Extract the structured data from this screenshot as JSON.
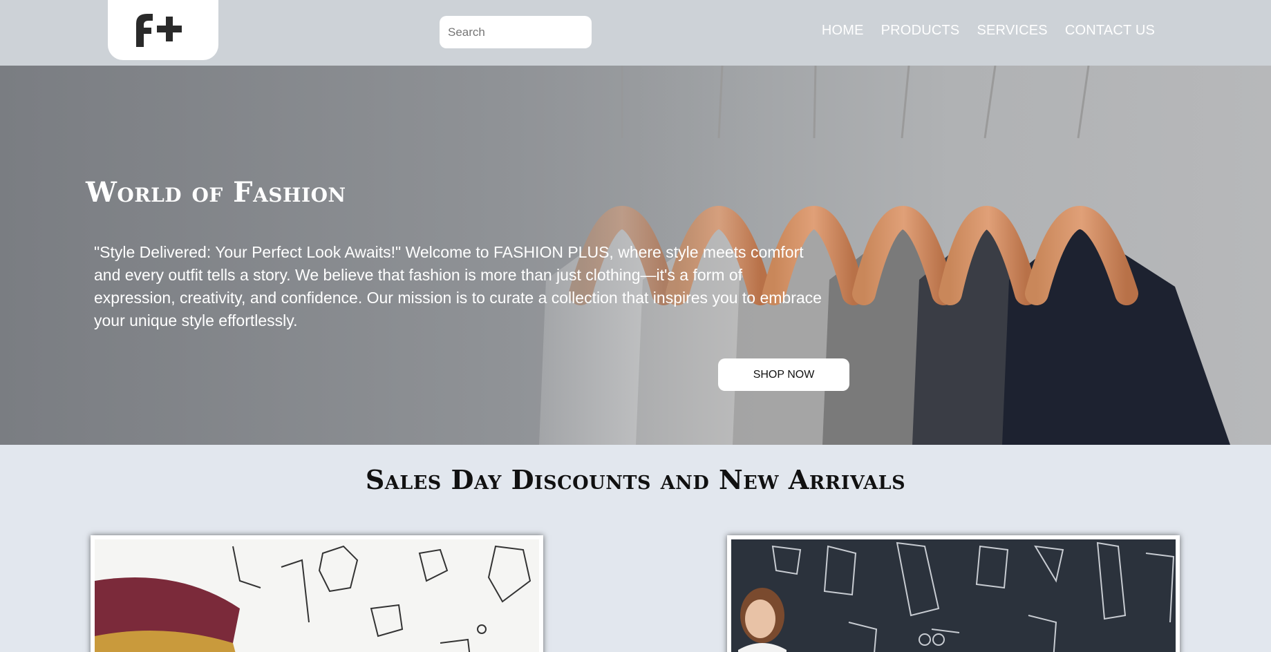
{
  "brand": {
    "logo_icon": "f-plus-logo-icon"
  },
  "search": {
    "placeholder": "Search",
    "value": ""
  },
  "nav": {
    "items": [
      {
        "label": "HOME"
      },
      {
        "label": "PRODUCTS"
      },
      {
        "label": "SERVICES"
      },
      {
        "label": "CONTACT US"
      }
    ]
  },
  "hero": {
    "title": "World of Fashion",
    "text": "\"Style Delivered: Your Perfect Look Awaits!\" Welcome to FASHION PLUS, where style meets comfort and every outfit tells a story. We believe that fashion is more than just clothing—it's a form of expression, creativity, and confidence. Our mission is to curate a collection that inspires you to embrace your unique style effortlessly.",
    "cta_label": "SHOP NOW"
  },
  "section": {
    "title": "Sales Day Discounts and New Arrivals"
  },
  "colors": {
    "header_bg": "#cdd2d7",
    "page_bg": "#e2e7ee",
    "nav_text": "#ffffff"
  }
}
